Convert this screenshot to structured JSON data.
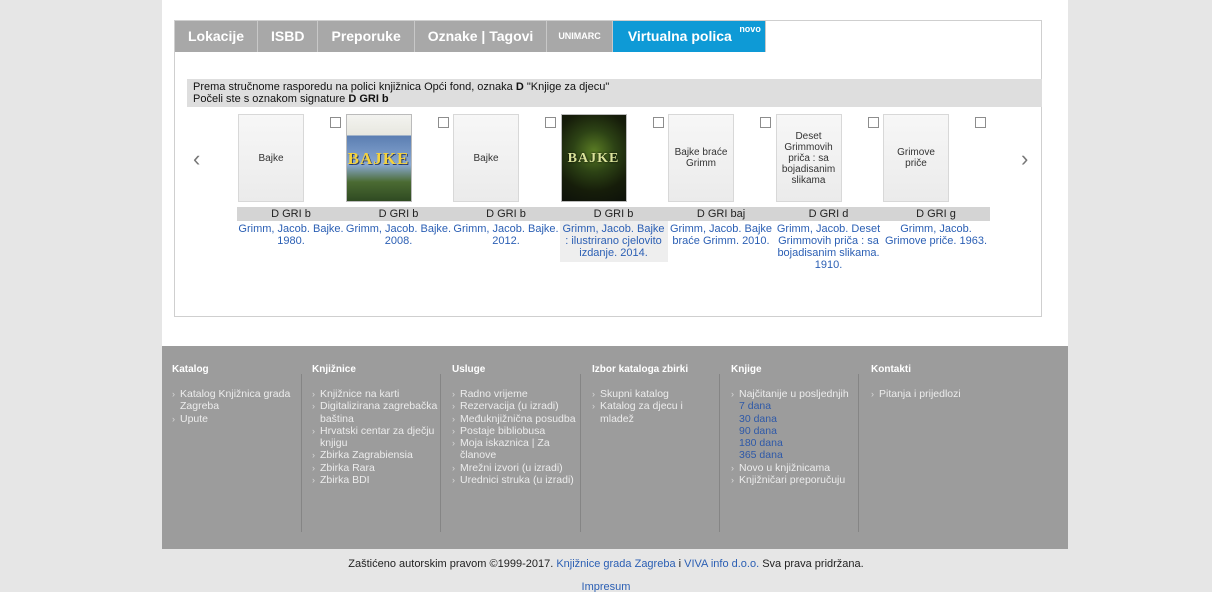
{
  "tabs": [
    {
      "label": "Lokacije",
      "small": false,
      "active": false
    },
    {
      "label": "ISBD",
      "small": false,
      "active": false
    },
    {
      "label": "Preporuke",
      "small": false,
      "active": false
    },
    {
      "label": "Oznake | Tagovi",
      "small": false,
      "active": false
    },
    {
      "label": "UNIMARC",
      "small": true,
      "active": false
    },
    {
      "label": "Virtualna polica",
      "small": false,
      "active": true,
      "badge": "novo"
    }
  ],
  "info": {
    "line1_prefix": "Prema stručnome rasporedu na polici knjižnica Opći fond, oznaka ",
    "line1_code": "D",
    "line1_suffix": " \"Knjige za djecu\"",
    "line2_prefix": "Počeli ste s oznakom signature ",
    "line2_code": "D GRI b"
  },
  "nav": {
    "prev": "‹",
    "next": "›"
  },
  "books": [
    {
      "cover_text": "Bajke",
      "cover_image": "",
      "signature": "D GRI b",
      "link": "Grimm, Jacob. Bajke. 1980.",
      "highlight": false
    },
    {
      "cover_text": "",
      "cover_image": "blue-cover",
      "cover_title": "BAJKE",
      "signature": "D GRI b",
      "link": "Grimm, Jacob. Bajke. 2008.",
      "highlight": false
    },
    {
      "cover_text": "Bajke",
      "cover_image": "",
      "signature": "D GRI b",
      "link": "Grimm, Jacob. Bajke. 2012.",
      "highlight": false
    },
    {
      "cover_text": "",
      "cover_image": "dark-cover",
      "cover_title": "BAJKE",
      "signature": "D GRI b",
      "link": "Grimm, Jacob. Bajke : ilustrirano cjelovito izdanje. 2014.",
      "highlight": true
    },
    {
      "cover_text": "Bajke braće Grimm",
      "cover_image": "",
      "signature": "D GRI baj",
      "link": "Grimm, Jacob. Bajke braće Grimm. 2010.",
      "highlight": false
    },
    {
      "cover_text": "Deset Grimmovih priča : sa bojadisanim slikama",
      "cover_image": "",
      "signature": "D GRI d",
      "link": "Grimm, Jacob. Deset Grimmovih priča : sa bojadisanim slikama. 1910.",
      "highlight": false
    },
    {
      "cover_text": "Grimove priče",
      "cover_image": "",
      "signature": "D GRI g",
      "link": "Grimm, Jacob. Grimove priče. 1963.",
      "highlight": false
    }
  ],
  "footer": [
    {
      "title": "Katalog",
      "items": [
        "Katalog Knjižnica grada Zagreba",
        "Upute"
      ]
    },
    {
      "title": "Knjižnice",
      "items": [
        "Knjižnice na karti",
        "Digitalizirana zagrebačka baština",
        "Hrvatski centar za dječju knjigu",
        "Zbirka Zagrabiensia",
        "Zbirka Rara",
        "Zbirka BDI"
      ]
    },
    {
      "title": "Usluge",
      "items": [
        "Radno vrijeme",
        "Rezervacija (u izradi)",
        "Međuknjižnična posudba",
        "Postaje bibliobusa",
        "Moja iskaznica | Za članove",
        "Mrežni izvori (u izradi)",
        "Urednici struka (u izradi)"
      ]
    },
    {
      "title": "Izbor kataloga zbirki",
      "items": [
        "Skupni katalog",
        "Katalog za djecu i mladež"
      ]
    },
    {
      "title": "Knjige",
      "items": [
        "Najčitanije u posljednjih",
        "7 dana",
        "30 dana",
        "90 dana",
        "180 dana",
        "365 dana",
        "Novo u knjižnicama",
        "Knjižničari preporučuju"
      ]
    },
    {
      "title": "Kontakti",
      "items": [
        "Pitanja i prijedlozi"
      ]
    }
  ],
  "copyright": {
    "prefix": "Zaštićeno autorskim pravom ©1999-2017. ",
    "link1": "Knjižnice grada Zagreba",
    "middle": " i ",
    "link2": "VIVA info d.o.o.",
    "suffix": " Sva prava pridržana."
  },
  "impressum": "Impresum",
  "colors": {
    "accent": "#0e9ad6",
    "link": "#2b5fb4",
    "footer_bg": "#9c9c9c",
    "tab_inactive": "#a8a8a8"
  }
}
